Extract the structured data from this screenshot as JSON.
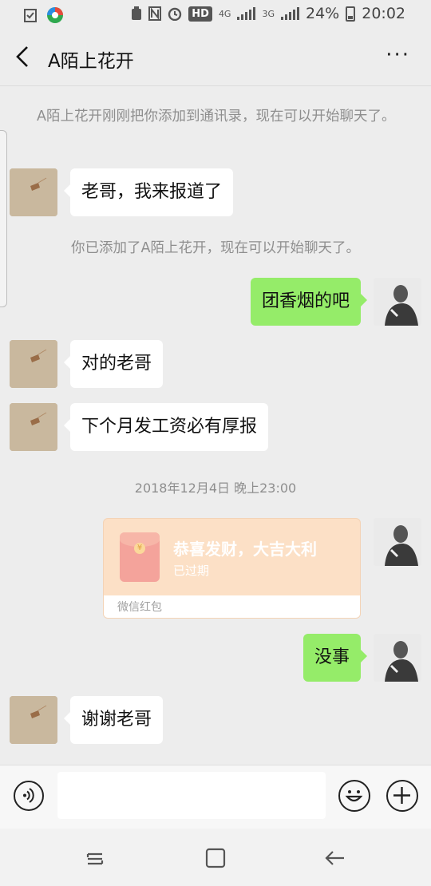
{
  "status_bar": {
    "hd_label": "HD",
    "net_4g": "4G",
    "net_3g": "3G",
    "battery": "24%",
    "time": "20:02"
  },
  "header": {
    "title": "A陌上花开",
    "more_label": "···"
  },
  "chat": {
    "system_1": "A陌上花开刚刚把你添加到通讯录，现在可以开始聊天了。",
    "msg_1": "老哥，我来报道了",
    "system_2": "你已添加了A陌上花开，现在可以开始聊天了。",
    "msg_2": "团香烟的吧",
    "msg_3": "对的老哥",
    "msg_4": "下个月发工资必有厚报",
    "timestamp": "2018年12月4日 晚上23:00",
    "red_packet": {
      "title": "恭喜发财，大吉大利",
      "status": "已过期",
      "label": "微信红包",
      "coin": "¥"
    },
    "msg_5": "没事",
    "msg_6": "谢谢老哥"
  },
  "input": {
    "placeholder": ""
  }
}
